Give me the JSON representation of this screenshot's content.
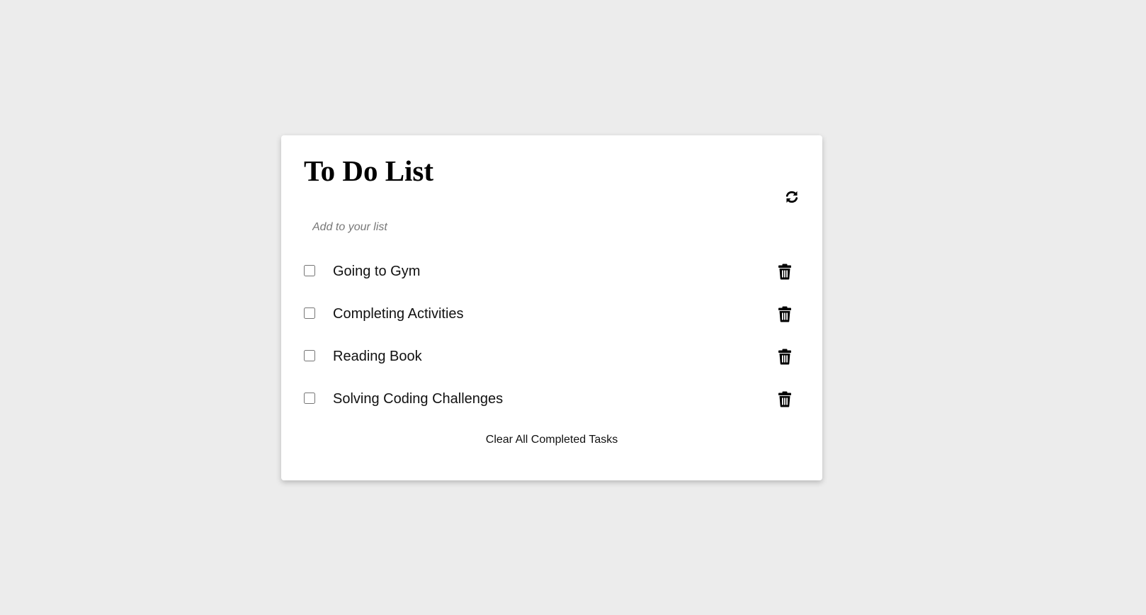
{
  "title": "To Do List",
  "input": {
    "placeholder": "Add to your list",
    "value": ""
  },
  "tasks": [
    {
      "label": "Going to Gym",
      "checked": false
    },
    {
      "label": "Completing Activities",
      "checked": false
    },
    {
      "label": "Reading Book",
      "checked": false
    },
    {
      "label": "Solving Coding Challenges",
      "checked": false
    }
  ],
  "clear_button": "Clear All Completed Tasks",
  "icons": {
    "refresh": "refresh-icon",
    "delete": "trash-icon"
  },
  "colors": {
    "background": "#ececec",
    "card": "#ffffff",
    "text": "#111111"
  }
}
